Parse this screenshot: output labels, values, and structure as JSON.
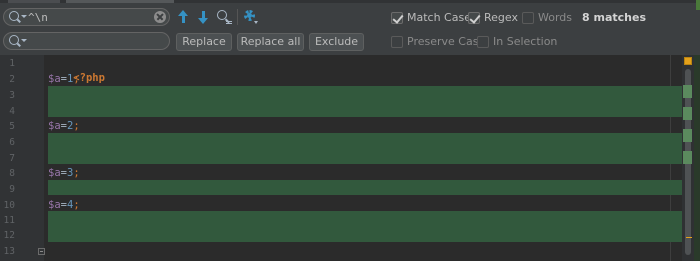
{
  "find": {
    "search_value": "^\\n",
    "replace_value": "",
    "buttons": {
      "replace": "Replace",
      "replace_all": "Replace all",
      "exclude": "Exclude"
    },
    "options": {
      "match_case": "Match Case",
      "regex": "Regex",
      "words": "Words",
      "preserve_case": "Preserve Case",
      "in_selection": "In Selection"
    },
    "option_state": {
      "match_case": true,
      "regex": true,
      "words": false,
      "preserve_case": false,
      "in_selection": false
    },
    "match_count": "8 matches"
  },
  "editor": {
    "line_numbers": [
      "1",
      "2",
      "3",
      "4",
      "5",
      "6",
      "7",
      "8",
      "9",
      "10",
      "11",
      "12",
      "13"
    ],
    "lines": {
      "l1": "<?php",
      "l2_var": "$a",
      "l2_op": "=",
      "l2_num": "1",
      "l2_semi": ";",
      "l5_var": "$a",
      "l5_op": "=",
      "l5_num": "2",
      "l5_semi": ";",
      "l8_var": "$a",
      "l8_op": "=",
      "l8_num": "3",
      "l8_semi": ";",
      "l10_var": "$a",
      "l10_op": "=",
      "l10_num": "4",
      "l10_semi": ";",
      "l13": "/*"
    },
    "match_lines": [
      3,
      4,
      6,
      7,
      9,
      11,
      12
    ],
    "colors": {
      "match_highlight": "#32593d",
      "keyword": "#cc7832",
      "variable": "#9876aa",
      "number": "#6897bb",
      "status_square": "#e4a11b"
    }
  }
}
